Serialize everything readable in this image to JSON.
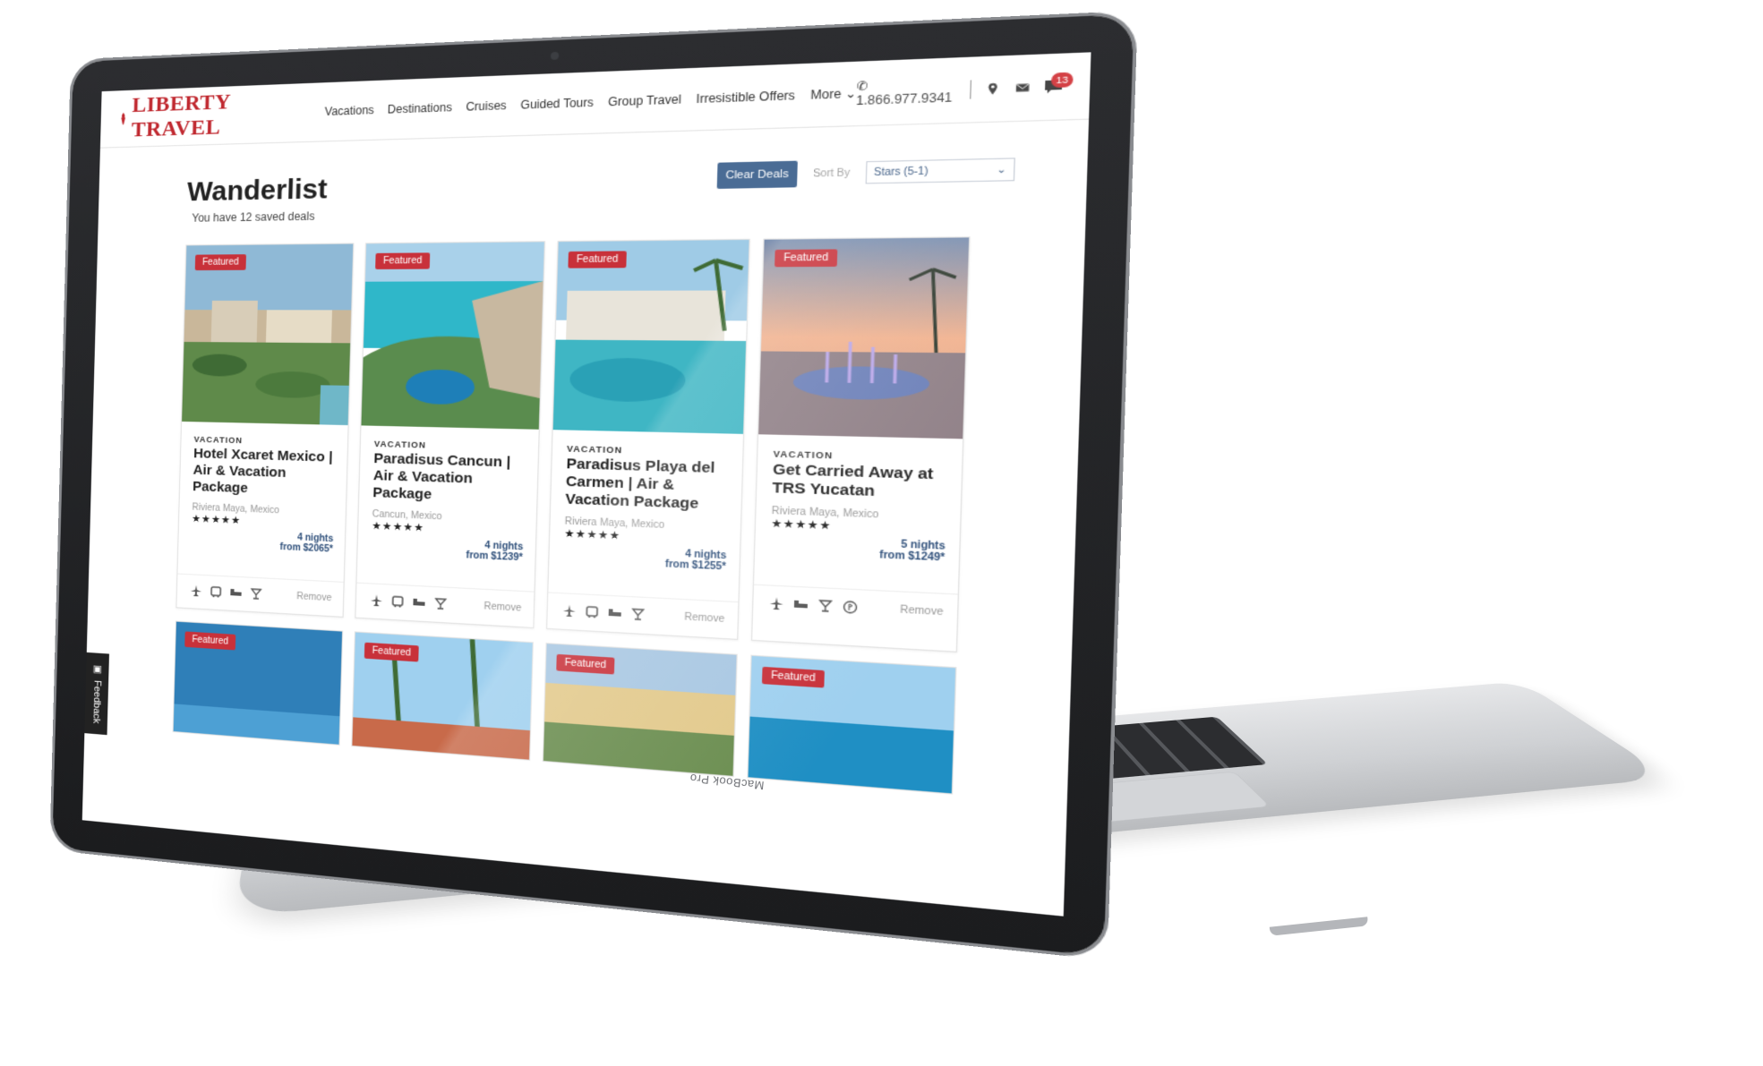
{
  "device": {
    "model_label": "MacBook Pro"
  },
  "brand": {
    "name": "LIBERTY TRAVEL",
    "accent": "#c0282f"
  },
  "nav": {
    "items": [
      "Vacations",
      "Destinations",
      "Cruises",
      "Guided Tours",
      "Group Travel",
      "Irresistible Offers",
      "More"
    ]
  },
  "header": {
    "phone": "1.866.977.9341",
    "chat_count": "13"
  },
  "page": {
    "title": "Wanderlist",
    "subtitle": "You have 12 saved deals",
    "clear_label": "Clear Deals",
    "sort_label": "Sort By",
    "sort_value": "Stars (5-1)"
  },
  "cards": [
    {
      "tag": "Featured",
      "type": "VACATION",
      "title": "Hotel Xcaret Mexico | Air & Vacation Package",
      "location": "Riviera Maya, Mexico",
      "stars": "★★★★★",
      "nights": "4 nights",
      "price": "from $2065*",
      "remove": "Remove"
    },
    {
      "tag": "Featured",
      "type": "VACATION",
      "title": "Paradisus Cancun | Air & Vacation Package",
      "location": "Cancun, Mexico",
      "stars": "★★★★★",
      "nights": "4 nights",
      "price": "from $1239*",
      "remove": "Remove"
    },
    {
      "tag": "Featured",
      "type": "VACATION",
      "title": "Paradisus Playa del Carmen | Air & Vacation Package",
      "location": "Riviera Maya, Mexico",
      "stars": "★★★★★",
      "nights": "4 nights",
      "price": "from $1255*",
      "remove": "Remove"
    },
    {
      "tag": "Featured",
      "type": "VACATION",
      "title": "Get Carried Away at TRS Yucatan",
      "location": "Riviera Maya, Mexico",
      "stars": "★★★★★",
      "nights": "5 nights",
      "price": "from $1249*",
      "remove": "Remove"
    }
  ],
  "row2_tags": [
    "Featured",
    "Featured",
    "Featured",
    "Featured"
  ],
  "feedback": {
    "label": "Feedback"
  }
}
